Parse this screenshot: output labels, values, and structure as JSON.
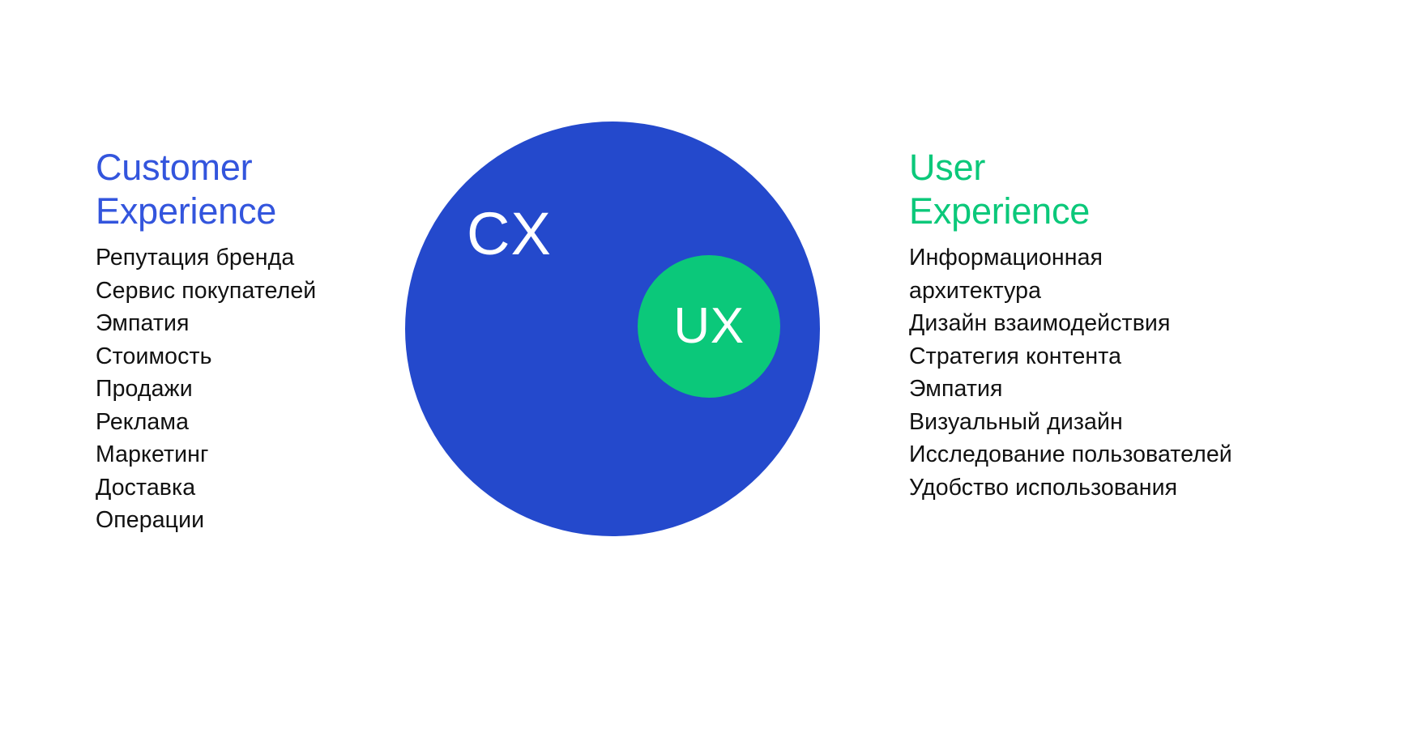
{
  "diagram": {
    "title_cx": "CX",
    "title_ux": "UX",
    "colors": {
      "cx_circle": "#2449cc",
      "ux_circle": "#0bc87a",
      "cx_heading": "#3355dd",
      "ux_heading": "#0bc87a",
      "label_text": "#ffffff",
      "list_text": "#111111",
      "background": "#ffffff"
    }
  },
  "left": {
    "heading": "Customer\nExperience",
    "items": [
      "Репутация бренда",
      "Сервис покупателей",
      "Эмпатия",
      "Стоимость",
      "Продажи",
      "Реклама",
      "Маркетинг",
      "Доставка",
      "Операции"
    ]
  },
  "right": {
    "heading": "User\nExperience",
    "items": [
      "Информационная архитектура",
      "Дизайн взаимодействия",
      "Стратегия контента",
      "Эмпатия",
      "Визуальный дизайн",
      "Исследование пользователей",
      "Удобство использования"
    ]
  }
}
